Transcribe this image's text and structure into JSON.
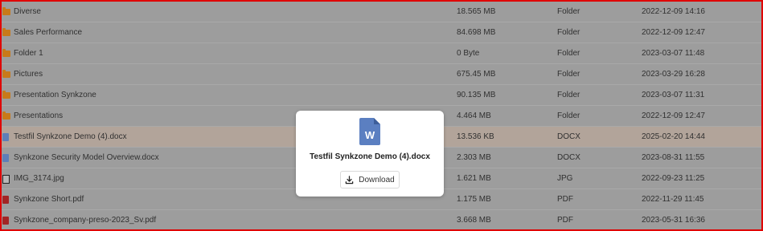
{
  "files": [
    {
      "name": "Diverse",
      "size": "18.565 MB",
      "type": "Folder",
      "date": "2022-12-09 14:16",
      "icon": "folder-icon",
      "selected": false
    },
    {
      "name": "Sales Performance",
      "size": "84.698 MB",
      "type": "Folder",
      "date": "2022-12-09 12:47",
      "icon": "folder-icon",
      "selected": false
    },
    {
      "name": "Folder 1",
      "size": "0 Byte",
      "type": "Folder",
      "date": "2023-03-07 11:48",
      "icon": "folder-icon",
      "selected": false
    },
    {
      "name": "Pictures",
      "size": "675.45 MB",
      "type": "Folder",
      "date": "2023-03-29 16:28",
      "icon": "folder-icon",
      "selected": false
    },
    {
      "name": "Presentation Synkzone",
      "size": "90.135 MB",
      "type": "Folder",
      "date": "2023-03-07 11:31",
      "icon": "folder-icon",
      "selected": false
    },
    {
      "name": "Presentations",
      "size": "4.464 MB",
      "type": "Folder",
      "date": "2022-12-09 12:47",
      "icon": "folder-icon",
      "selected": false
    },
    {
      "name": "Testfil Synkzone Demo (4).docx",
      "size": "13.536 KB",
      "type": "DOCX",
      "date": "2025-02-20 14:44",
      "icon": "word-doc-icon",
      "selected": true
    },
    {
      "name": "Synkzone Security Model Overview.docx",
      "size": "2.303 MB",
      "type": "DOCX",
      "date": "2023-08-31 11:55",
      "icon": "word-doc-icon",
      "selected": false
    },
    {
      "name": "IMG_3174.jpg",
      "size": "1.621 MB",
      "type": "JPG",
      "date": "2022-09-23 11:25",
      "icon": "image-file-icon",
      "selected": false
    },
    {
      "name": "Synkzone Short.pdf",
      "size": "1.175 MB",
      "type": "PDF",
      "date": "2022-11-29 11:45",
      "icon": "pdf-icon",
      "selected": false
    },
    {
      "name": "Synkzone_company-preso-2023_Sv.pdf",
      "size": "3.668 MB",
      "type": "PDF",
      "date": "2023-05-31 16:36",
      "icon": "pdf-icon",
      "selected": false
    }
  ],
  "popup": {
    "icon": "word-doc-icon",
    "icon_letter": "W",
    "filename": "Testfil Synkzone Demo (4).docx",
    "download_label": "Download",
    "download_icon": "download-icon"
  },
  "colors": {
    "overlay_bg": "#9d9d9d",
    "selected_row": "#b2a49a",
    "frame_border": "#e00000",
    "word_blue": "#5b7fc1",
    "folder": "#c87a1a",
    "pdf": "#a32424"
  }
}
